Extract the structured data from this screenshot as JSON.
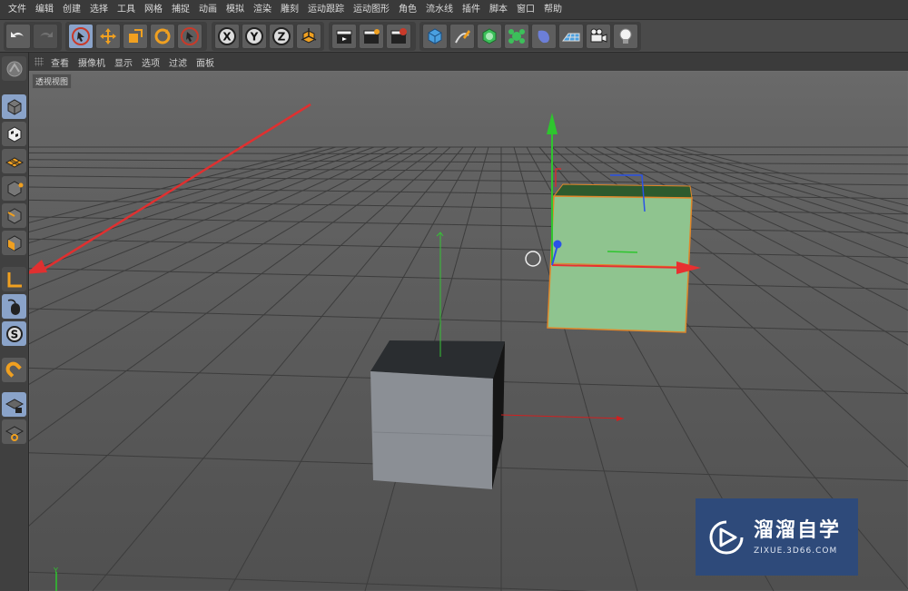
{
  "menu": [
    "文件",
    "编辑",
    "创建",
    "选择",
    "工具",
    "网格",
    "捕捉",
    "动画",
    "模拟",
    "渲染",
    "雕刻",
    "运动跟踪",
    "运动图形",
    "角色",
    "流水线",
    "插件",
    "脚本",
    "窗口",
    "帮助"
  ],
  "viewport_menu": [
    "查看",
    "摄像机",
    "显示",
    "选项",
    "过滤",
    "面板"
  ],
  "viewport_label": "透视视图",
  "toolbar": {
    "groups": [
      "history",
      "transform",
      "axis",
      "keys",
      "objects"
    ],
    "axis_x": "X",
    "axis_y": "Y",
    "axis_z": "Z"
  },
  "leftbar": {
    "snap_label": "S"
  },
  "watermark": {
    "brand": "溜溜自学",
    "url": "ZIXUE.3D66.COM"
  },
  "scene": {
    "selected_cube_color": "#8fc48f",
    "gray_cube_color": "#8c9096",
    "arrow_color": "#e03030",
    "grid_color": "#3c3c3c"
  }
}
